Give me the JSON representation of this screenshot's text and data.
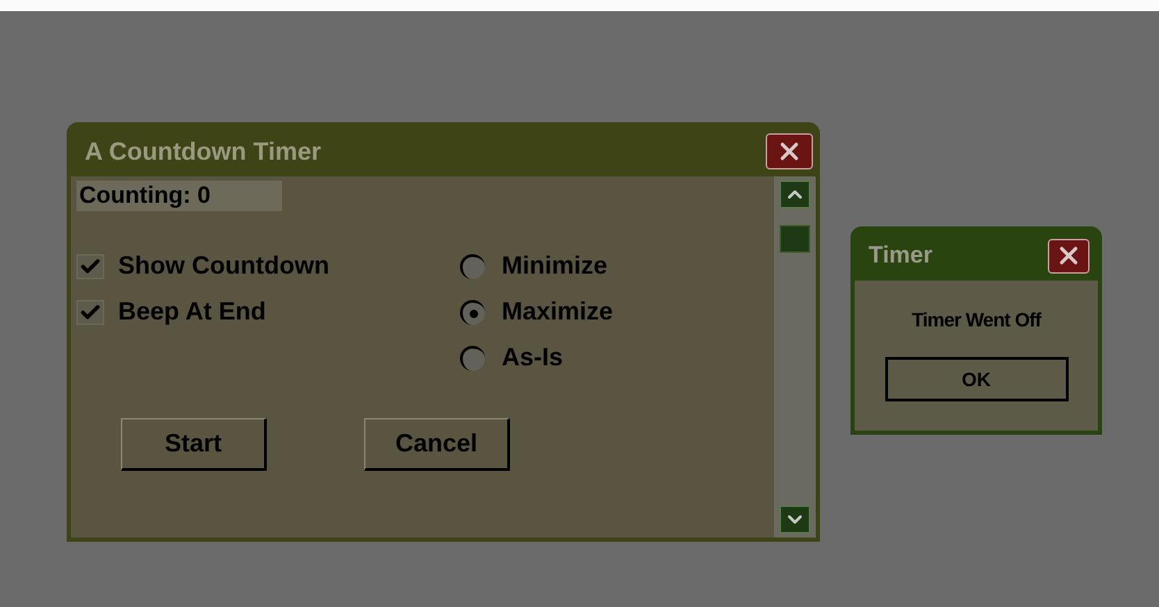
{
  "main_window": {
    "title": "A Countdown Timer",
    "counter": "Counting: 0",
    "checkboxes": [
      {
        "label": "Show Countdown",
        "checked": true
      },
      {
        "label": "Beep At End",
        "checked": true
      }
    ],
    "radios": [
      {
        "label": "Minimize",
        "selected": false
      },
      {
        "label": "Maximize",
        "selected": true
      },
      {
        "label": "As-Is",
        "selected": false
      }
    ],
    "buttons": [
      "Start",
      "Cancel"
    ]
  },
  "dialog": {
    "title": "Timer",
    "message": "Timer Went Off",
    "button": "OK"
  }
}
